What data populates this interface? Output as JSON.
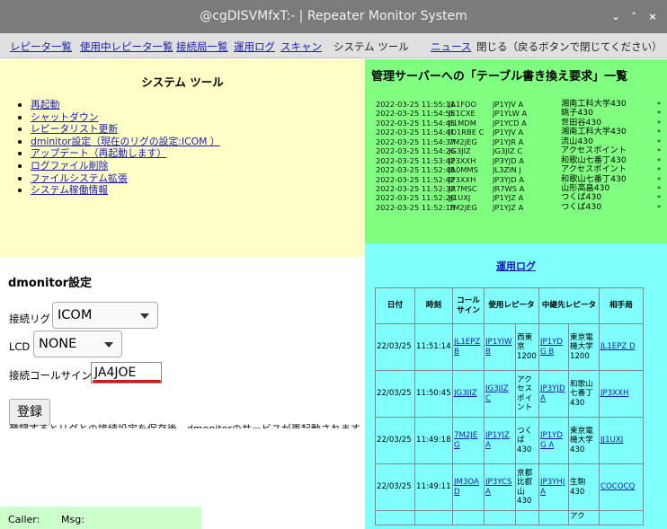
{
  "window": {
    "title": "@cgDISVMfxT:- | Repeater Monitor System",
    "controls": [
      "⌄",
      "˄",
      "×"
    ]
  },
  "menu": {
    "items": [
      {
        "label": "レピータ一覧",
        "link": true
      },
      {
        "label": "使用中レピータ一覧",
        "link": true
      },
      {
        "label": "接続局一覧",
        "link": true
      },
      {
        "label": "運用ログ",
        "link": true
      },
      {
        "label": "スキャン",
        "link": true
      },
      {
        "label": "システム ツール",
        "link": false
      },
      {
        "label": "ニュース",
        "link": true
      },
      {
        "label": "閉じる（戻るボタンで閉じてください）",
        "link": false
      }
    ]
  },
  "system_tools": {
    "title": "システム ツール",
    "items": [
      "再起動",
      "シャットダウン",
      "レピータリスト更新",
      "dminitor設定（現在のリグの設定:ICOM ）",
      "アップデート（再起動します）",
      "ログファイル削除",
      "ファイルシステム拡張",
      "システム稼働情報"
    ]
  },
  "dmonitor": {
    "title": "dmonitor設定",
    "rig_label": "接続リグ",
    "rig_value": "ICOM",
    "lcd_label": "LCD",
    "lcd_value": "NONE",
    "callsign_label": "接続コールサイン",
    "callsign_value": "JA4JOE",
    "register_label": "登録",
    "note": "登録するとリグとの接続設定を保存後、dmonitorのサービスが再起動されます。"
  },
  "caller_bar": {
    "caller_label": "Caller:",
    "msg_label": "Msg:"
  },
  "requests": {
    "title": "管理サーバーへの「テーブル書き換え要求」一覧",
    "rows": [
      {
        "time": "2022-03-25 11:55:11",
        "call": "JA1FOO",
        "rpt": "JP1YJV A",
        "dest": "湘南工科大学430",
        "flag": "*"
      },
      {
        "time": "2022-03-25 11:54:55",
        "call": "JE1CXE",
        "rpt": "JP1YLW A",
        "dest": "銚子430",
        "flag": "*"
      },
      {
        "time": "2022-03-25 11:54:45",
        "call": "JI1MDM",
        "rpt": "JP1YCD A",
        "dest": "世田谷430",
        "flag": "*"
      },
      {
        "time": "2022-03-25 11:54:41",
        "call": "JO1RBE C",
        "rpt": "JP1YJV A",
        "dest": "湘南工科大学430",
        "flag": "*"
      },
      {
        "time": "2022-03-25 11:54:37",
        "call": "7M2JEG",
        "rpt": "JP1YJR A",
        "dest": "流山430",
        "flag": "*"
      },
      {
        "time": "2022-03-25 11:54:26",
        "call": "JG3JIZ",
        "rpt": "JG3JIZ C",
        "dest": "アクセスポイント",
        "flag": "*"
      },
      {
        "time": "2022-03-25 11:53:42",
        "call": "JP3XXH",
        "rpt": "JP3YJD A",
        "dest": "和歌山七番丁430",
        "flag": "*"
      },
      {
        "time": "2022-03-25 11:52:45",
        "call": "JA0MMS",
        "rpt": "JL3ZIN J",
        "dest": "アクセスポイント",
        "flag": "*"
      },
      {
        "time": "2022-03-25 11:52:42",
        "call": "JP3XXH",
        "rpt": "JP3YJD A",
        "dest": "和歌山七番丁430",
        "flag": "*"
      },
      {
        "time": "2022-03-25 11:52:32",
        "call": "JR7MSC",
        "rpt": "JR7WS A",
        "dest": "山形高畠430",
        "flag": "*"
      },
      {
        "time": "2022-03-25 11:52:26",
        "call": "JJ1UXJ",
        "rpt": "JP1YJZ A",
        "dest": "つくば430",
        "flag": "*"
      },
      {
        "time": "2022-03-25 11:52:18",
        "call": "7M2JEG",
        "rpt": "JP1YJZ A",
        "dest": "つくば430",
        "flag": "*"
      }
    ]
  },
  "log": {
    "title": "運用ログ",
    "headers": [
      "日付",
      "時刻",
      "コールサイン",
      "使用レピータ",
      "",
      "中継先レピータ",
      "",
      "相手局"
    ],
    "rows": [
      {
        "date": "22/03/25",
        "time": "11:51:14",
        "call": "JL1EPZ B",
        "rpt_call": "JP1YIW B",
        "rpt_name": "西東京1200",
        "link_call": "JP1YDG B",
        "link_name": "東京電機大学1200",
        "partner": "JL1EPZ D"
      },
      {
        "date": "22/03/25",
        "time": "11:50:45",
        "call": "JG3JIZ",
        "rpt_call": "JG3JIZ C",
        "rpt_name": "アクセスポイント",
        "link_call": "JP3YJD A",
        "link_name": "和歌山七番丁430",
        "partner": "JP3XXH"
      },
      {
        "date": "22/03/25",
        "time": "11:49:18",
        "call": "7M2JEG",
        "rpt_call": "JP1YJZ A",
        "rpt_name": "つくば430",
        "link_call": "JP1YDG A",
        "link_name": "東京電機大学430",
        "partner": "JJ1UXJ"
      },
      {
        "date": "22/03/25",
        "time": "11:49:11",
        "call": "JM3OAD",
        "rpt_call": "JP3YCS A",
        "rpt_name": "京都比叡山430",
        "link_call": "JP3YHJ A",
        "link_name": "生駒430",
        "partner": "COCOCQ"
      }
    ],
    "partial_row_text": "アク"
  }
}
